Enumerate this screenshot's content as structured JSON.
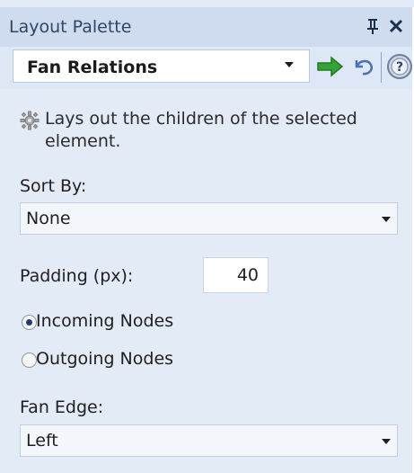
{
  "panel": {
    "title": "Layout Palette"
  },
  "toolbar": {
    "layout_type": "Fan Relations"
  },
  "description": "Lays out the children of the selected element.",
  "sort_by": {
    "label": "Sort By:",
    "value": "None"
  },
  "padding": {
    "label": "Padding (px):",
    "value": "40"
  },
  "nodes": {
    "incoming_label": "Incoming Nodes",
    "outgoing_label": "Outgoing Nodes",
    "selected": "incoming"
  },
  "fan_edge": {
    "label": "Fan Edge:",
    "value": "Left"
  },
  "icons": {
    "pin": "pin-icon",
    "close": "close-icon",
    "apply": "arrow-right-icon",
    "undo": "undo-icon",
    "help": "help-icon",
    "description": "gear-icon"
  },
  "colors": {
    "panel_bg": "#e3ebf7",
    "title_bg": "#cfdcef",
    "title_text": "#2e4666",
    "apply_arrow": "#2f9e2f"
  }
}
